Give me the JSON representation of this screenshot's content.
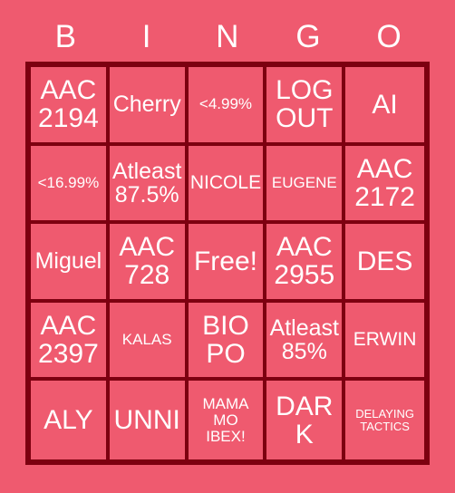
{
  "card": {
    "title": "BINGO",
    "header_letters": [
      "B",
      "I",
      "N",
      "G",
      "O"
    ],
    "colors": {
      "background": "#ef5a6f",
      "cell_fill": "#ef5a6f",
      "border": "#7d0010",
      "text": "#ffffff"
    },
    "grid_size": "5x5",
    "free_space_label": "Free!",
    "rows": [
      [
        {
          "text": "AAC\n2194",
          "size": "fs-xl"
        },
        {
          "text": "Cherry",
          "size": "fs-lg"
        },
        {
          "text": "<4.99%",
          "size": "fs-sm"
        },
        {
          "text": "LOG\nOUT",
          "size": "fs-xl"
        },
        {
          "text": "AI",
          "size": "fs-xl"
        }
      ],
      [
        {
          "text": "<16.99%",
          "size": "fs-sm"
        },
        {
          "text": "Atleast\n87.5%",
          "size": "fs-lg"
        },
        {
          "text": "NICOLE",
          "size": "fs-md"
        },
        {
          "text": "EUGENE",
          "size": "fs-sm"
        },
        {
          "text": "AAC\n2172",
          "size": "fs-xl"
        }
      ],
      [
        {
          "text": "Miguel",
          "size": "fs-lg"
        },
        {
          "text": "AAC\n728",
          "size": "fs-xl"
        },
        {
          "text": "Free!",
          "size": "fs-xl"
        },
        {
          "text": "AAC\n2955",
          "size": "fs-xl"
        },
        {
          "text": "DES",
          "size": "fs-xl"
        }
      ],
      [
        {
          "text": "AAC\n2397",
          "size": "fs-xl"
        },
        {
          "text": "KALAS",
          "size": "fs-sm"
        },
        {
          "text": "BIO\nPO",
          "size": "fs-xl"
        },
        {
          "text": "Atleast\n85%",
          "size": "fs-lg"
        },
        {
          "text": "ERWIN",
          "size": "fs-md"
        }
      ],
      [
        {
          "text": "ALY",
          "size": "fs-xl"
        },
        {
          "text": "UNNI",
          "size": "fs-xl"
        },
        {
          "text": "MAMA\nMO\nIBEX!",
          "size": "fs-sm"
        },
        {
          "text": "DARK",
          "size": "fs-xl"
        },
        {
          "text": "DELAYING\nTACTICS",
          "size": "fs-xs"
        }
      ]
    ]
  }
}
